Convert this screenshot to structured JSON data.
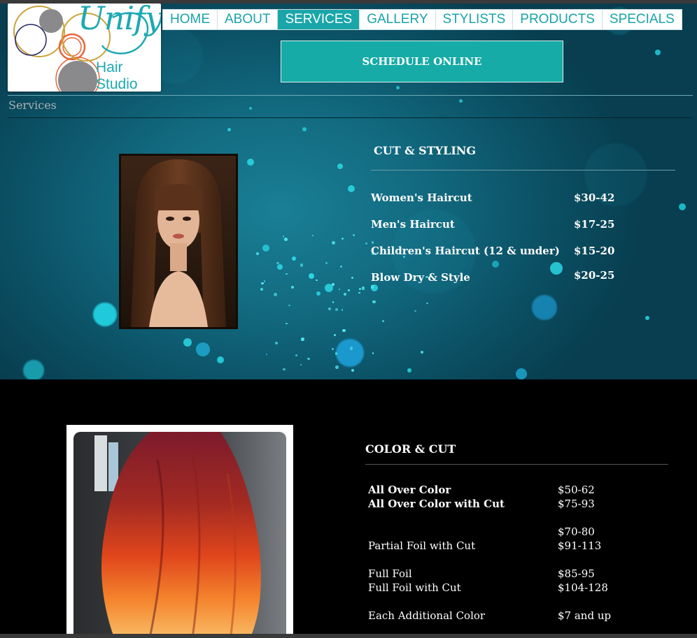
{
  "logo": {
    "script_text": "Unify",
    "sub_text": "Hair Studio"
  },
  "nav": {
    "items": [
      "HOME",
      "ABOUT",
      "SERVICES",
      "GALLERY",
      "STYLISTS",
      "PRODUCTS",
      "SPECIALS"
    ],
    "active": "SERVICES"
  },
  "schedule_label": "SCHEDULE ONLINE",
  "breadcrumb": "Services",
  "cut_styling": {
    "title": "CUT & STYLING",
    "services": [
      {
        "name": "Women's Haircut",
        "price": "$30-42"
      },
      {
        "name": "Men's Haircut",
        "price": "$17-25"
      },
      {
        "name": "Children's Haircut (12 & under)",
        "price": "$15-20"
      },
      {
        "name": "Blow Dry & Style",
        "price": "$20-25"
      }
    ]
  },
  "color_cut": {
    "title": "COLOR & CUT",
    "rows": [
      {
        "name": "All Over Color",
        "price": "$50-62"
      },
      {
        "name": "All Over Color with Cut",
        "price": "$75-93"
      },
      {
        "name": "",
        "price": "$70-80"
      },
      {
        "name": "Partial Foil with Cut",
        "price": "$91-113"
      },
      {
        "name": "Full Foil",
        "price": "$85-95"
      },
      {
        "name": "Full Foil with Cut",
        "price": "$104-128"
      },
      {
        "name": "Each Additional Color",
        "price": "$7 and up"
      }
    ]
  },
  "colors": {
    "teal_accent": "#1aa6a9",
    "background_teal": "#126a80",
    "lower_background": "#000000"
  }
}
